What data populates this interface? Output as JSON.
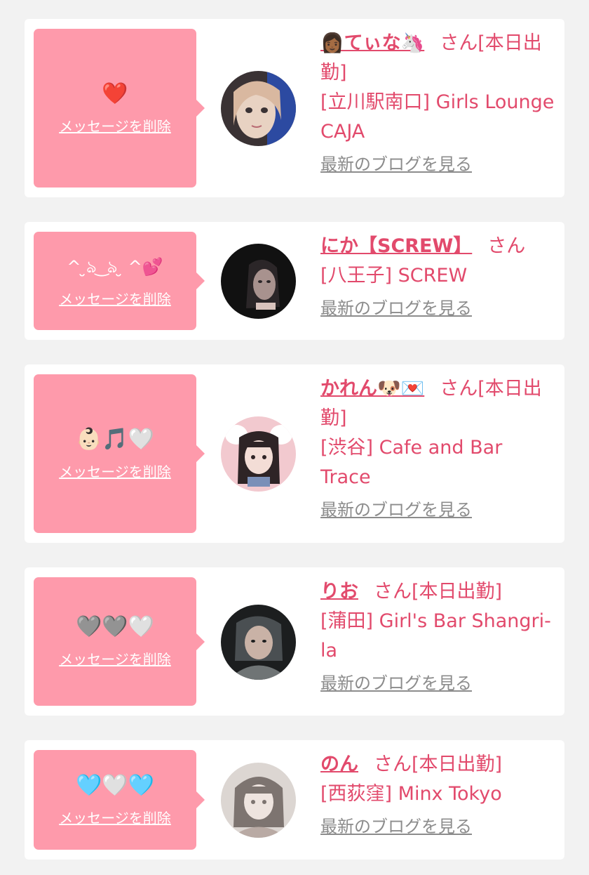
{
  "colors": {
    "page_background": "#f2f2f2",
    "card_background": "#ffffff",
    "message_bubble": "#fe9aab",
    "name_text": "#e24a6c",
    "blog_link": "#8c8c8c"
  },
  "cards": [
    {
      "message": "❤️",
      "delete_label": "メッセージを削除",
      "name": "👩🏾てぃな🦄",
      "honorific": "さん",
      "status": "[本日出勤]",
      "shop": "[立川駅南口] Girls Lounge CAJA",
      "blog_label": "最新のブログを見る",
      "avatar_palette": [
        "#3a3234",
        "#d9b8a0",
        "#2a4fb5",
        "#e8d2c2"
      ]
    },
    {
      "message": "^ ̮ঌ ͜ ঌ ̮ ^💕",
      "delete_label": "メッセージを削除",
      "name": "にか【SCREW】",
      "honorific": "さん",
      "status": "",
      "shop": "[八王子] SCREW",
      "blog_label": "最新のブログを見る",
      "avatar_palette": [
        "#111111",
        "#2b2628",
        "#a8928e",
        "#d9c3bd"
      ]
    },
    {
      "message": "👶🏻🎵🤍",
      "delete_label": "メッセージを削除",
      "name": "かれん🐶💌",
      "honorific": "さん",
      "status": "[本日出勤]",
      "shop": "[渋谷] Cafe and Bar Trace",
      "blog_label": "最新のブログを見る",
      "avatar_palette": [
        "#f2c9cf",
        "#2e2426",
        "#f3ddd6",
        "#7a8fb8"
      ]
    },
    {
      "message": "🩶🩶🤍",
      "delete_label": "メッセージを削除",
      "name": "りお",
      "honorific": "さん",
      "status": "[本日出勤]",
      "shop": "[蒲田] Girl's Bar Shangri-la",
      "blog_label": "最新のブログを見る",
      "avatar_palette": [
        "#1c1e1f",
        "#6f7475",
        "#c9b2a6",
        "#4a4f52"
      ]
    },
    {
      "message": "🩵🤍🩵",
      "delete_label": "メッセージを削除",
      "name": "のん",
      "honorific": "さん",
      "status": "[本日出勤]",
      "shop": "[西荻窪] Minx Tokyo",
      "blog_label": "最新のブログを見る",
      "avatar_palette": [
        "#dcd6d2",
        "#7d7470",
        "#eee4df",
        "#b9aaa4"
      ]
    }
  ]
}
